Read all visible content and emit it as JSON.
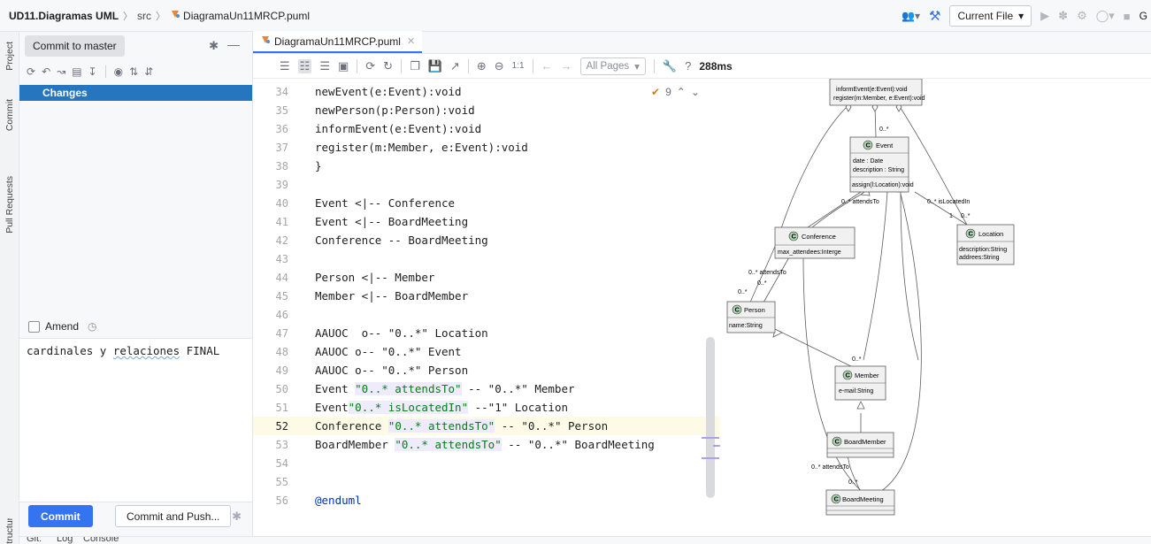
{
  "breadcrumb": {
    "project": "UD11.Diagramas UML",
    "folder": "src",
    "file": "DiagramaUn11MRCP.puml"
  },
  "toolbar": {
    "run_config": "Current File",
    "truncated_text": "G"
  },
  "side_stripe": [
    "Project",
    "Commit",
    "Pull Requests",
    "Structure"
  ],
  "commit_panel": {
    "tab": "Commit to master",
    "changes_label": "Changes",
    "amend_label": "Amend",
    "message_parts": [
      "cardinales y ",
      "relaciones",
      " FINAL"
    ],
    "commit_button": "Commit",
    "commit_push_button": "Commit and Push..."
  },
  "bottom_tabs": [
    "Git:",
    "Log",
    "Console"
  ],
  "editor": {
    "tab_label": "DiagramaUn11MRCP.puml",
    "pages_selector": "All Pages",
    "render_time": "288ms",
    "one_to_one": "1:1",
    "help": "?",
    "inspection_count": "9",
    "current_line": "52",
    "lines": [
      {
        "num": "34",
        "text": "newEvent(e:Event):void"
      },
      {
        "num": "35",
        "text": "newPerson(p:Person):void"
      },
      {
        "num": "36",
        "text": "informEvent(e:Event):void"
      },
      {
        "num": "37",
        "text": "register(m:Member, e:Event):void"
      },
      {
        "num": "38",
        "text": "}"
      },
      {
        "num": "39",
        "text": ""
      },
      {
        "num": "40",
        "text": "Event <|-- Conference"
      },
      {
        "num": "41",
        "text": "Event <|-- BoardMeeting"
      },
      {
        "num": "42",
        "text": "Conference -- BoardMeeting"
      },
      {
        "num": "43",
        "text": ""
      },
      {
        "num": "44",
        "text": "Person <|-- Member"
      },
      {
        "num": "45",
        "text": "Member <|-- BoardMember"
      },
      {
        "num": "46",
        "text": ""
      },
      {
        "num": "47",
        "text": "AAUOC  o-- \"0..*\" Location"
      },
      {
        "num": "48",
        "text": "AAUOC o-- \"0..*\" Event"
      },
      {
        "num": "49",
        "text": "AAUOC o-- \"0..*\" Person"
      },
      {
        "num": "50",
        "text": "Event \"0..* attendsTo\" -- \"0..*\" Member"
      },
      {
        "num": "51",
        "text": "Event\"0..* isLocatedIn\" --\"1\" Location"
      },
      {
        "num": "52",
        "text": "Conference \"0..* attendsTo\" -- \"0..*\" Person"
      },
      {
        "num": "53",
        "text": "BoardMember \"0..* attendsTo\" -- \"0..*\" BoardMeeting"
      },
      {
        "num": "54",
        "text": ""
      },
      {
        "num": "55",
        "text": ""
      },
      {
        "num": "56",
        "text": "@enduml"
      }
    ]
  },
  "diagram": {
    "top_ops": [
      "informEvent(e:Event):void",
      "register(m:Member, e:Event):void"
    ],
    "classes": [
      {
        "name": "Event",
        "attrs": [
          "date : Date",
          "description : String"
        ],
        "ops": [
          "assign(l:Location):void"
        ]
      },
      {
        "name": "Conference",
        "attrs": [
          "max_attendees:Interge"
        ],
        "ops": []
      },
      {
        "name": "Location",
        "attrs": [
          "description:String",
          "addrees:String"
        ],
        "ops": []
      },
      {
        "name": "Person",
        "attrs": [
          "name:String"
        ],
        "ops": []
      },
      {
        "name": "Member",
        "attrs": [
          "e-mail:String"
        ],
        "ops": []
      },
      {
        "name": "BoardMember",
        "attrs": [],
        "ops": []
      },
      {
        "name": "BoardMeeting",
        "attrs": [],
        "ops": []
      }
    ],
    "labels": {
      "event_mult": "0..*",
      "attends_event": "0..* attendsTo",
      "located": "0..* isLocatedIn",
      "one": "1",
      "loc_mult": "0..*",
      "attends_conf": "0..* attendsTo",
      "person_mult_a": "0..*",
      "person_mult_b": "0..*",
      "member_mult": "0..*",
      "attends_bm": "0..* attendsTo",
      "bmeeting_mult": "0..*"
    },
    "stereotype_letter": "C"
  }
}
